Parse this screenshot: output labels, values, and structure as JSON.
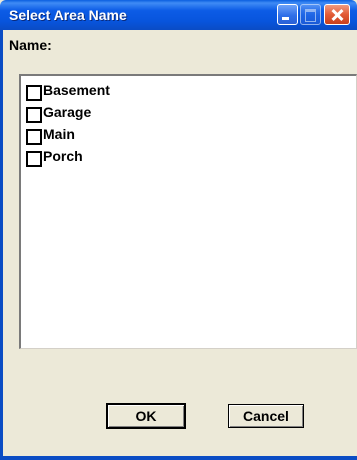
{
  "window": {
    "title": "Select Area Name"
  },
  "label": "Name:",
  "areas": [
    {
      "label": "Basement",
      "checked": false
    },
    {
      "label": "Garage",
      "checked": false
    },
    {
      "label": "Main",
      "checked": false
    },
    {
      "label": "Porch",
      "checked": false
    }
  ],
  "buttons": {
    "ok": "OK",
    "cancel": "Cancel"
  }
}
